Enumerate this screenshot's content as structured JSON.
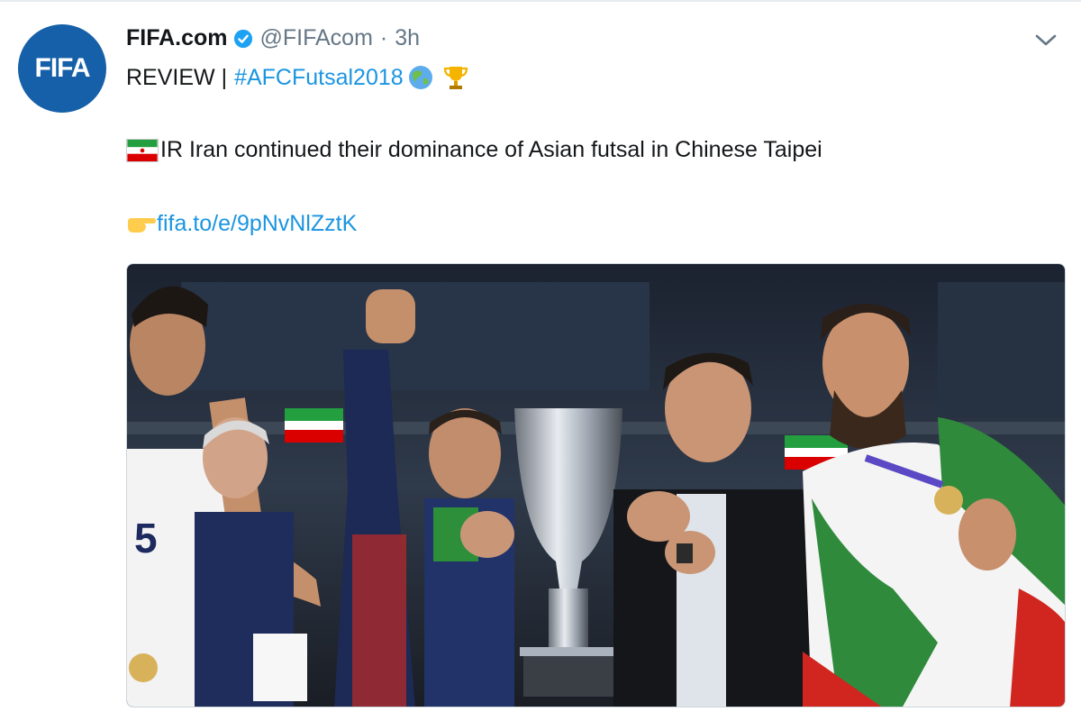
{
  "author": {
    "avatar_text": "FIFA",
    "display_name": "FIFA.com",
    "handle": "@FIFAcom",
    "separator": "·",
    "time": "3h"
  },
  "tweet": {
    "prefix": "REVIEW |",
    "hashtag": "#AFCFutsal2018",
    "body_text": "IR Iran continued their dominance of Asian futsal in Chinese Taipei",
    "link": "fifa.to/e/9pNvNlZztK"
  },
  "icons": {
    "verified": "verified-badge-icon",
    "globe": "globe-asia-icon",
    "trophy": "trophy-icon",
    "flag": "iran-flag-icon",
    "pointing": "pointing-right-icon",
    "menu": "chevron-down-icon"
  },
  "colors": {
    "link": "#1b95e0",
    "avatar": "#1560a8",
    "muted": "#657786"
  }
}
